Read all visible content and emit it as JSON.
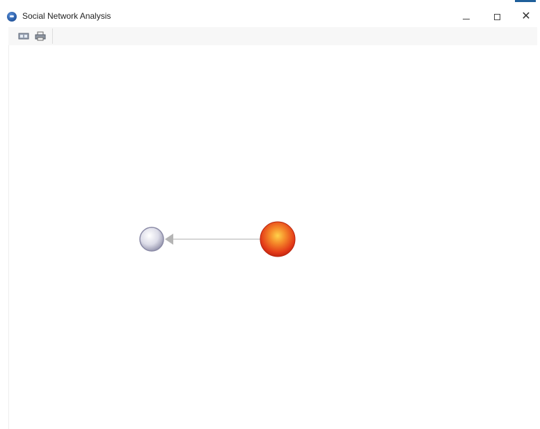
{
  "window": {
    "title": "Social Network Analysis",
    "icon": "app-network-icon",
    "controls": {
      "minimize": "minimize-icon",
      "maximize": "maximize-icon",
      "close": "close-icon",
      "close_glyph": "✕"
    }
  },
  "toolbar": {
    "items": [
      {
        "icon": "layout-icon"
      },
      {
        "icon": "print-icon"
      }
    ]
  },
  "graph": {
    "nodes": [
      {
        "id": "node-a",
        "color": "#d9d9e6",
        "style": "grey-sphere"
      },
      {
        "id": "node-b",
        "color": "#e8401c",
        "style": "red-sphere"
      }
    ],
    "edges": [
      {
        "from": "node-b",
        "to": "node-a",
        "directed": true,
        "color": "#c8c8c8"
      }
    ]
  }
}
